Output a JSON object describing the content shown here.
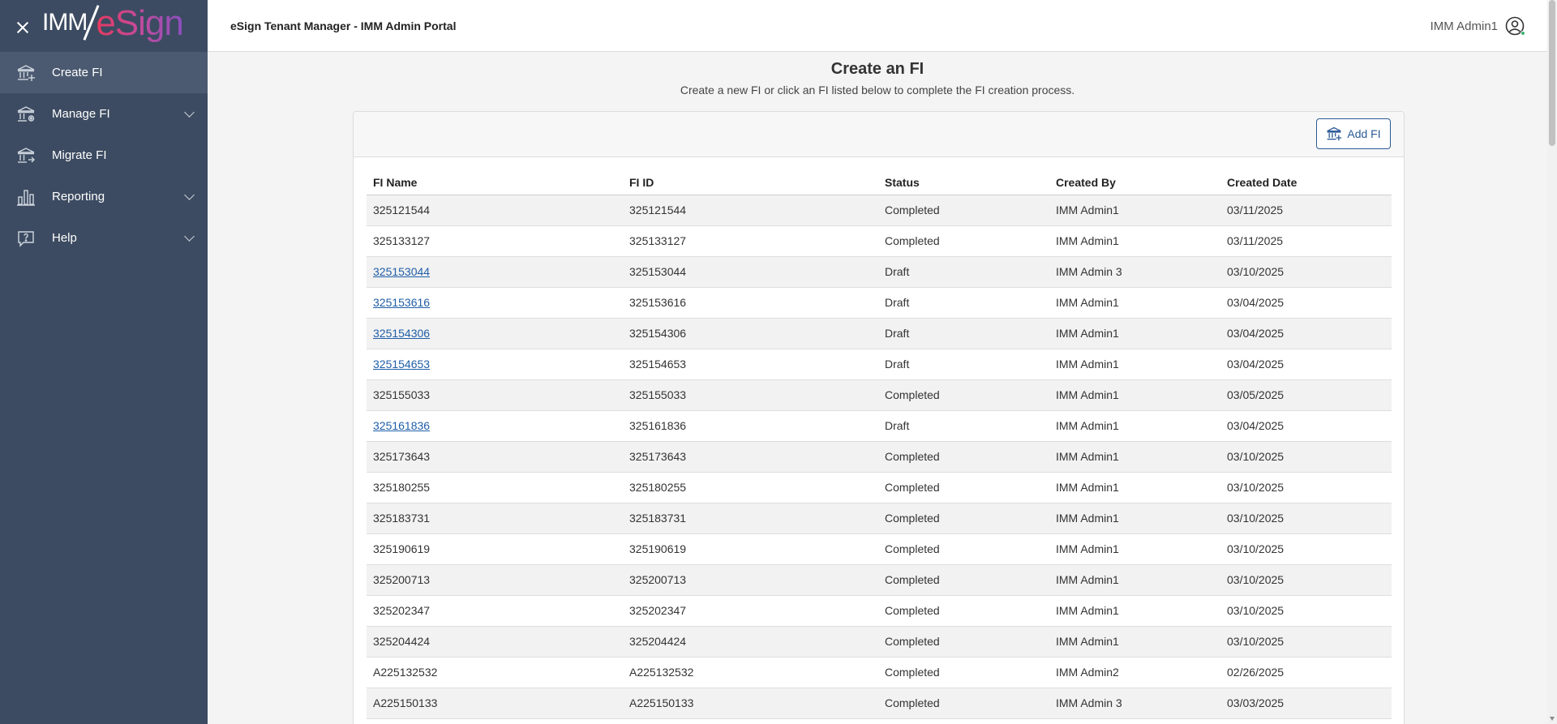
{
  "brand": {
    "logo_left": "IMM",
    "logo_right": "eSign"
  },
  "header": {
    "title": "eSign Tenant Manager - IMM Admin Portal",
    "user_name": "IMM Admin1"
  },
  "sidebar": {
    "items": [
      {
        "label": "Create FI",
        "icon": "bank-add-icon",
        "active": true
      },
      {
        "label": "Manage FI",
        "icon": "bank-gear-icon",
        "expandable": true
      },
      {
        "label": "Migrate FI",
        "icon": "bank-arrow-icon"
      },
      {
        "label": "Reporting",
        "icon": "bar-chart-icon",
        "expandable": true
      },
      {
        "label": "Help",
        "icon": "help-bubble-icon",
        "expandable": true
      }
    ]
  },
  "page": {
    "title": "Create an FI",
    "subtitle": "Create a new FI or click an FI listed below to complete the FI creation process.",
    "add_button": "Add FI"
  },
  "table": {
    "columns": [
      "FI Name",
      "FI ID",
      "Status",
      "Created By",
      "Created Date"
    ],
    "rows": [
      {
        "name": "325121544",
        "id": "325121544",
        "status": "Completed",
        "created_by": "IMM Admin1",
        "date": "03/11/2025",
        "link": false
      },
      {
        "name": "325133127",
        "id": "325133127",
        "status": "Completed",
        "created_by": "IMM Admin1",
        "date": "03/11/2025",
        "link": false
      },
      {
        "name": "325153044",
        "id": "325153044",
        "status": "Draft",
        "created_by": "IMM Admin 3",
        "date": "03/10/2025",
        "link": true
      },
      {
        "name": "325153616",
        "id": "325153616",
        "status": "Draft",
        "created_by": "IMM Admin1",
        "date": "03/04/2025",
        "link": true
      },
      {
        "name": "325154306",
        "id": "325154306",
        "status": "Draft",
        "created_by": "IMM Admin1",
        "date": "03/04/2025",
        "link": true
      },
      {
        "name": "325154653",
        "id": "325154653",
        "status": "Draft",
        "created_by": "IMM Admin1",
        "date": "03/04/2025",
        "link": true
      },
      {
        "name": "325155033",
        "id": "325155033",
        "status": "Completed",
        "created_by": "IMM Admin1",
        "date": "03/05/2025",
        "link": false
      },
      {
        "name": "325161836",
        "id": "325161836",
        "status": "Draft",
        "created_by": "IMM Admin1",
        "date": "03/04/2025",
        "link": true
      },
      {
        "name": "325173643",
        "id": "325173643",
        "status": "Completed",
        "created_by": "IMM Admin1",
        "date": "03/10/2025",
        "link": false
      },
      {
        "name": "325180255",
        "id": "325180255",
        "status": "Completed",
        "created_by": "IMM Admin1",
        "date": "03/10/2025",
        "link": false
      },
      {
        "name": "325183731",
        "id": "325183731",
        "status": "Completed",
        "created_by": "IMM Admin1",
        "date": "03/10/2025",
        "link": false
      },
      {
        "name": "325190619",
        "id": "325190619",
        "status": "Completed",
        "created_by": "IMM Admin1",
        "date": "03/10/2025",
        "link": false
      },
      {
        "name": "325200713",
        "id": "325200713",
        "status": "Completed",
        "created_by": "IMM Admin1",
        "date": "03/10/2025",
        "link": false
      },
      {
        "name": "325202347",
        "id": "325202347",
        "status": "Completed",
        "created_by": "IMM Admin1",
        "date": "03/10/2025",
        "link": false
      },
      {
        "name": "325204424",
        "id": "325204424",
        "status": "Completed",
        "created_by": "IMM Admin1",
        "date": "03/10/2025",
        "link": false
      },
      {
        "name": "A225132532",
        "id": "A225132532",
        "status": "Completed",
        "created_by": "IMM Admin2",
        "date": "02/26/2025",
        "link": false
      },
      {
        "name": "A225150133",
        "id": "A225150133",
        "status": "Completed",
        "created_by": "IMM Admin 3",
        "date": "03/03/2025",
        "link": false
      }
    ]
  },
  "colors": {
    "sidebar_bg": "#3c4b61",
    "sidebar_active": "#4b5a70",
    "link": "#1f5ea8",
    "accent": "#2a5a96"
  }
}
